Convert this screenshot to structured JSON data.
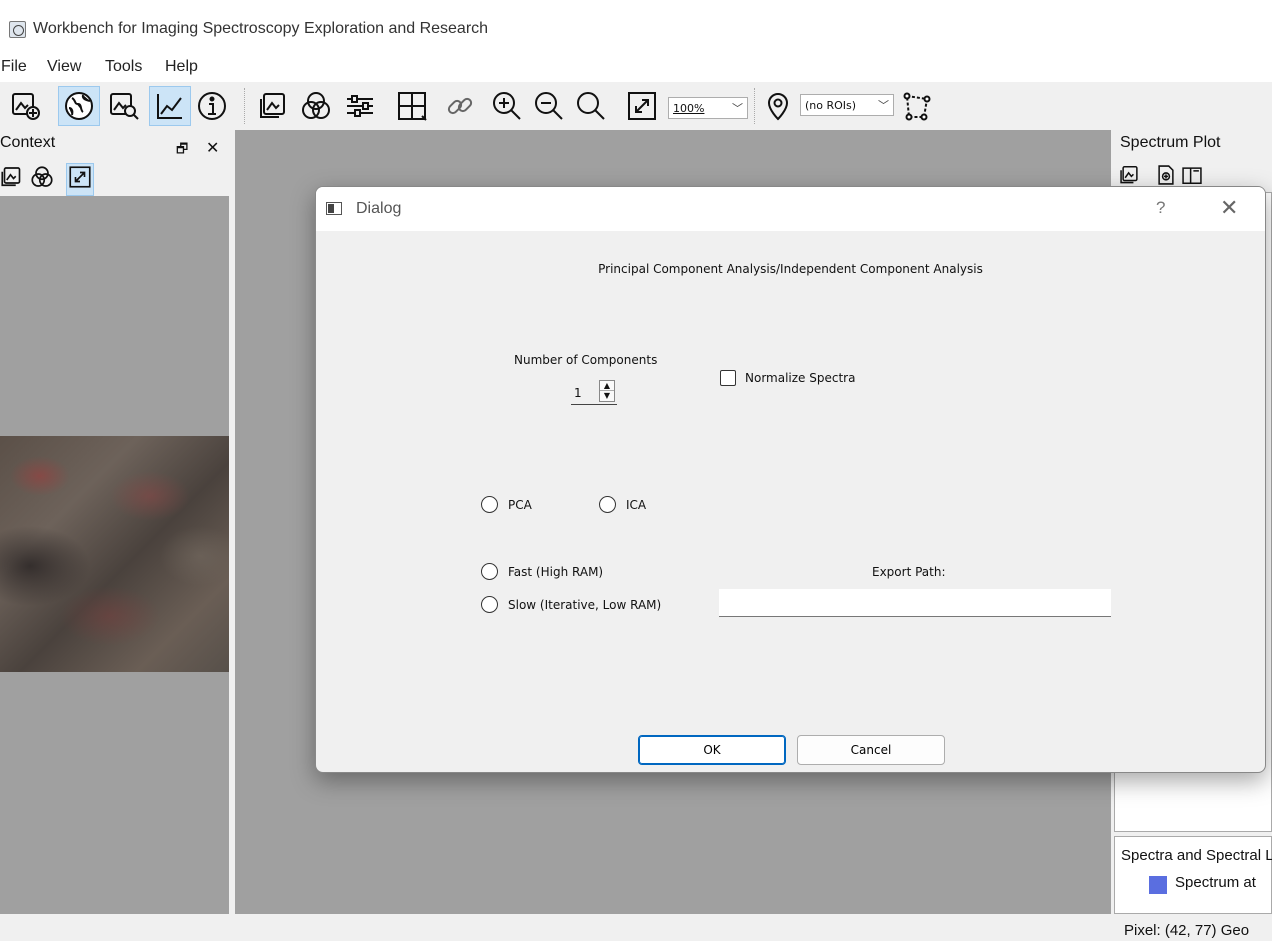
{
  "window": {
    "title": "Workbench for Imaging Spectroscopy Exploration and Research"
  },
  "menu": [
    "File",
    "View",
    "Tools",
    "Help"
  ],
  "toolbar": {
    "zoom_level": "100%",
    "roi_select": "(no ROIs)",
    "icons": [
      "add-image-icon",
      "geo-globe-icon",
      "zoom-image-icon",
      "spectrum-plot-icon",
      "info-icon",
      "image-stretch-icon",
      "bands-icon",
      "sliders-icon",
      "grid-icon",
      "link-icon",
      "zoom-in-icon",
      "zoom-out-icon",
      "zoom-reset-icon",
      "fit-icon",
      "location-pin-icon",
      "polygon-roi-icon"
    ]
  },
  "context_panel": {
    "title": "Context",
    "float_glyph": "🗗",
    "close_glyph": "✕"
  },
  "spectrum_panel": {
    "title": "Spectrum Plot",
    "list_title": "Spectra and Spectral Libraries",
    "list_item": "Spectrum at"
  },
  "status": {
    "text": "Pixel: (42, 77)  Geo"
  },
  "dialog": {
    "title": "Dialog",
    "help_glyph": "?",
    "close_glyph": "✕",
    "heading": "Principal Component Analysis/Independent Component Analysis",
    "num_components_label": "Number of Components",
    "num_components_value": "1",
    "normalize_label": "Normalize Spectra",
    "normalize_checked": false,
    "method_options": [
      "PCA",
      "ICA"
    ],
    "speed_options": [
      "Fast (High RAM)",
      "Slow (Iterative, Low RAM)"
    ],
    "export_label": "Export Path:",
    "export_value": "",
    "ok_label": "OK",
    "cancel_label": "Cancel"
  }
}
